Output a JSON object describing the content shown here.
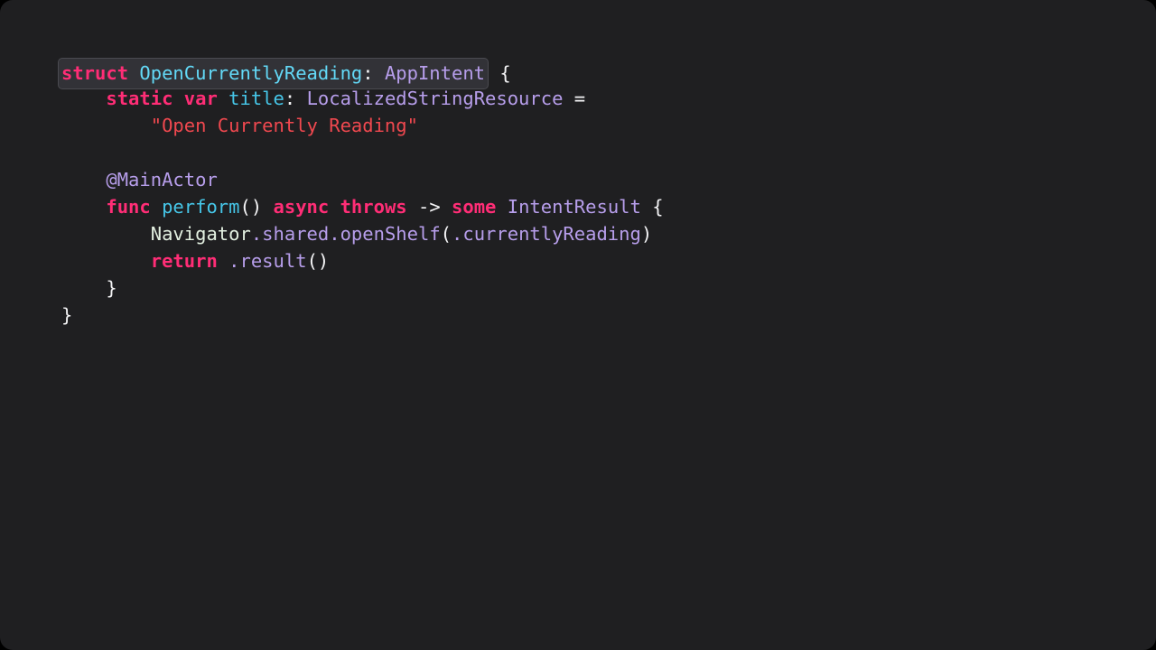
{
  "slide": {
    "background_color": "#1f1f21",
    "outer_color": "#000000",
    "language": "swift"
  },
  "highlight": {
    "background_color": "#323237",
    "border_color": "#4a4a50",
    "target_line": 0
  },
  "palette": {
    "keyword": "#ff2d76",
    "type": "#b79eeb",
    "type_cyan": "#63d9f7",
    "function": "#46c6e8",
    "property": "#46c6e8",
    "plain": "#f4f4f6",
    "member": "#b79eeb",
    "string": "#f0484f",
    "attribute": "#b79eeb",
    "identifier": "#e3f0e1"
  },
  "code": {
    "lines": [
      {
        "id": "line-struct-declaration",
        "highlighted": true,
        "indent": 0,
        "tokens": [
          {
            "text": "struct",
            "kind": "kw"
          },
          {
            "text": " ",
            "kind": "plain"
          },
          {
            "text": "OpenCurrentlyReading",
            "kind": "typecy"
          },
          {
            "text": ": ",
            "kind": "plain"
          },
          {
            "text": "AppIntent",
            "kind": "type"
          }
        ],
        "trailing": [
          {
            "text": " {",
            "kind": "plain"
          }
        ]
      },
      {
        "id": "line-static-var-title",
        "highlighted": false,
        "indent": 0,
        "tokens": [
          {
            "text": "    ",
            "kind": "plain"
          },
          {
            "text": "static",
            "kind": "kw"
          },
          {
            "text": " ",
            "kind": "plain"
          },
          {
            "text": "var",
            "kind": "kw"
          },
          {
            "text": " ",
            "kind": "plain"
          },
          {
            "text": "title",
            "kind": "prop"
          },
          {
            "text": ": ",
            "kind": "plain"
          },
          {
            "text": "LocalizedStringResource",
            "kind": "type"
          },
          {
            "text": " =",
            "kind": "plain"
          }
        ],
        "trailing": []
      },
      {
        "id": "line-title-string",
        "highlighted": false,
        "indent": 0,
        "tokens": [
          {
            "text": "        ",
            "kind": "plain"
          },
          {
            "text": "\"Open Currently Reading\"",
            "kind": "str"
          }
        ],
        "trailing": []
      },
      {
        "id": "line-blank-1",
        "highlighted": false,
        "indent": 0,
        "tokens": [],
        "trailing": []
      },
      {
        "id": "line-main-actor-attribute",
        "highlighted": false,
        "indent": 0,
        "tokens": [
          {
            "text": "    ",
            "kind": "plain"
          },
          {
            "text": "@MainActor",
            "kind": "attr"
          }
        ],
        "trailing": []
      },
      {
        "id": "line-func-perform",
        "highlighted": false,
        "indent": 0,
        "tokens": [
          {
            "text": "    ",
            "kind": "plain"
          },
          {
            "text": "func",
            "kind": "kw"
          },
          {
            "text": " ",
            "kind": "plain"
          },
          {
            "text": "perform",
            "kind": "fn"
          },
          {
            "text": "() ",
            "kind": "plain"
          },
          {
            "text": "async",
            "kind": "kw"
          },
          {
            "text": " ",
            "kind": "plain"
          },
          {
            "text": "throws",
            "kind": "kw"
          },
          {
            "text": " -> ",
            "kind": "plain"
          },
          {
            "text": "some",
            "kind": "kw"
          },
          {
            "text": " ",
            "kind": "plain"
          },
          {
            "text": "IntentResult",
            "kind": "type"
          },
          {
            "text": " {",
            "kind": "plain"
          }
        ],
        "trailing": []
      },
      {
        "id": "line-navigator-open-shelf",
        "highlighted": false,
        "indent": 0,
        "tokens": [
          {
            "text": "        ",
            "kind": "plain"
          },
          {
            "text": "Navigator",
            "kind": "ident"
          },
          {
            "text": ".shared",
            "kind": "member"
          },
          {
            "text": ".openShelf",
            "kind": "member"
          },
          {
            "text": "(",
            "kind": "plain"
          },
          {
            "text": ".currentlyReading",
            "kind": "member"
          },
          {
            "text": ")",
            "kind": "plain"
          }
        ],
        "trailing": []
      },
      {
        "id": "line-return-result",
        "highlighted": false,
        "indent": 0,
        "tokens": [
          {
            "text": "        ",
            "kind": "plain"
          },
          {
            "text": "return",
            "kind": "kw"
          },
          {
            "text": " ",
            "kind": "plain"
          },
          {
            "text": ".result",
            "kind": "member"
          },
          {
            "text": "()",
            "kind": "plain"
          }
        ],
        "trailing": []
      },
      {
        "id": "line-close-func-brace",
        "highlighted": false,
        "indent": 0,
        "tokens": [
          {
            "text": "    }",
            "kind": "plain"
          }
        ],
        "trailing": []
      },
      {
        "id": "line-close-struct-brace",
        "highlighted": false,
        "indent": 0,
        "tokens": [
          {
            "text": "}",
            "kind": "plain"
          }
        ],
        "trailing": []
      }
    ]
  }
}
